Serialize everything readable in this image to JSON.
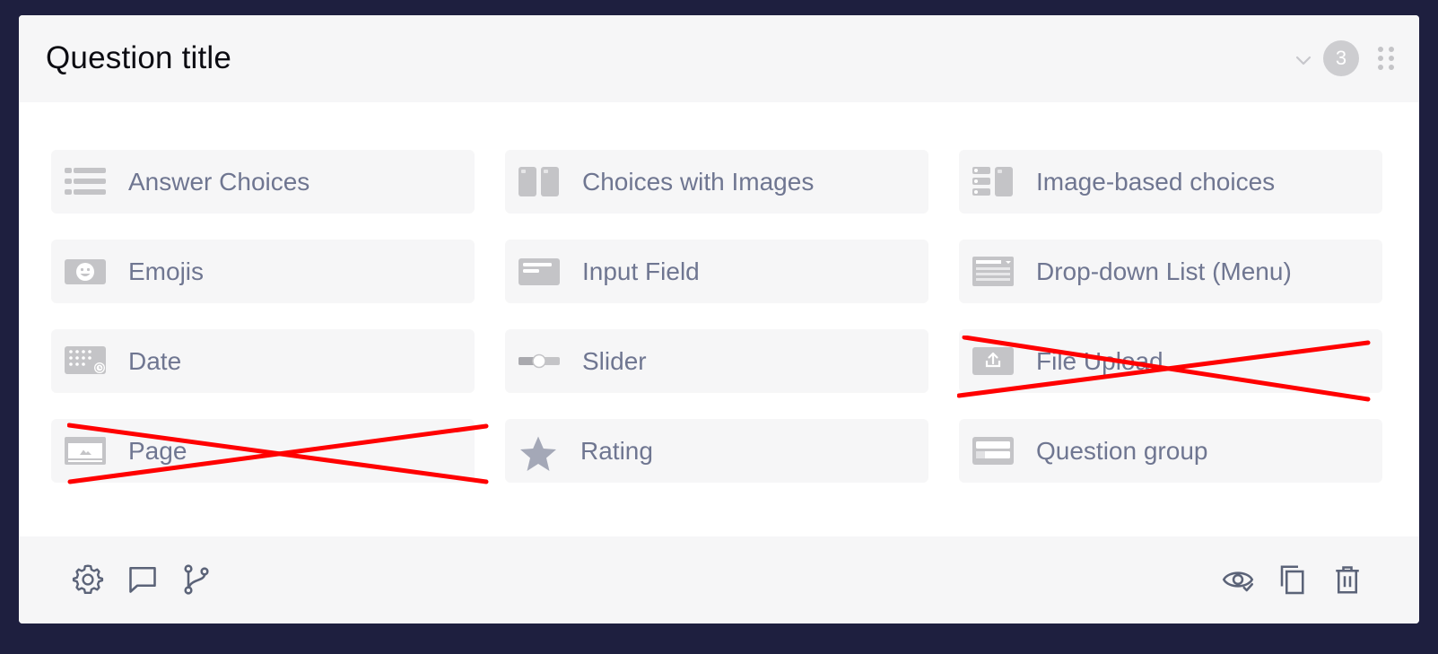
{
  "header": {
    "title": "Question title",
    "badge_count": "3",
    "icons": [
      "chevron-down-icon",
      "drag-handle-icon"
    ]
  },
  "options": [
    {
      "label": "Answer Choices",
      "icon": "answer-choices-icon",
      "disabled": false
    },
    {
      "label": "Choices with Images",
      "icon": "choices-with-images-icon",
      "disabled": false
    },
    {
      "label": "Image-based choices",
      "icon": "image-based-choices-icon",
      "disabled": false
    },
    {
      "label": "Emojis",
      "icon": "emoji-icon",
      "disabled": false
    },
    {
      "label": "Input Field",
      "icon": "input-field-icon",
      "disabled": false
    },
    {
      "label": "Drop-down List (Menu)",
      "icon": "dropdown-list-icon",
      "disabled": false
    },
    {
      "label": "Date",
      "icon": "date-icon",
      "disabled": false
    },
    {
      "label": "Slider",
      "icon": "slider-icon",
      "disabled": false
    },
    {
      "label": "File Upload",
      "icon": "file-upload-icon",
      "disabled": true
    },
    {
      "label": "Page",
      "icon": "page-icon",
      "disabled": true
    },
    {
      "label": "Rating",
      "icon": "star-icon",
      "disabled": false
    },
    {
      "label": "Question group",
      "icon": "question-group-icon",
      "disabled": false
    }
  ],
  "footer": {
    "left_icons": [
      "settings-gear-icon",
      "comment-icon",
      "branch-logic-icon"
    ],
    "right_icons": [
      "visibility-eye-icon",
      "duplicate-icon",
      "delete-trash-icon"
    ]
  },
  "colors": {
    "background": "#1e1f3f",
    "card": "#ffffff",
    "panel": "#f6f6f7",
    "label": "#6f7691",
    "icon": "#c4c4c7",
    "strike": "#ff0000",
    "toolbar_icon": "#5b6378"
  }
}
